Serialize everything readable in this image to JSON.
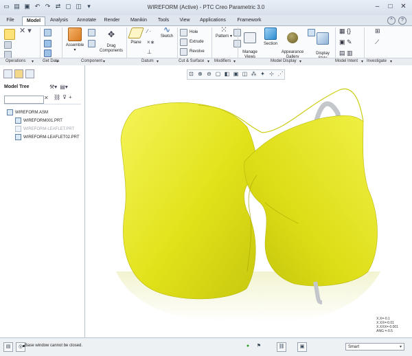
{
  "app": {
    "title": "WIREFORM (Active) - PTC Creo Parametric 3.0"
  },
  "tabs": [
    "File",
    "Model",
    "Analysis",
    "Annotate",
    "Render",
    "Manikin",
    "Tools",
    "View",
    "Applications",
    "Framework"
  ],
  "active_tab": "Model",
  "ribbon": {
    "assemble": "Assemble",
    "drag_components": "Drag\nComponents",
    "plane": "Plane",
    "sketch": "Sketch",
    "hole": "Hole",
    "extrude": "Extrude",
    "revolve": "Revolve",
    "pattern": "Pattern",
    "manage_views": "Manage\nViews",
    "section": "Section",
    "appearance_gallery": "Appearance\nGallery",
    "display_style": "Display\nStyle"
  },
  "groups": [
    "Operations",
    "Get Data",
    "Component",
    "Datum",
    "Cut & Surface",
    "Modifiers",
    "Model Display",
    "Model Intent",
    "Investigate"
  ],
  "model_tree": {
    "header": "Model Tree",
    "items": [
      {
        "label": "WIREFORM.ASM",
        "dim": false
      },
      {
        "label": "WIREFORM001.PRT",
        "dim": false
      },
      {
        "label": "WIREFORM-LEAFLET.PRT",
        "dim": true
      },
      {
        "label": "WIREFORM-LEAFLET02.PRT",
        "dim": false
      }
    ]
  },
  "coords": {
    "l1": "X.X=-0.1",
    "l2": "X.XX=-0.01",
    "l3": "X.XXX=-0.001",
    "l4": "ANG =-0.5"
  },
  "status": {
    "message": "Base window cannot be closed."
  },
  "filter": {
    "value": "Smart"
  },
  "colors": {
    "leaflet": "#e6e61c",
    "wireform": "#c9cdd2",
    "accent": "#2a62b0"
  }
}
